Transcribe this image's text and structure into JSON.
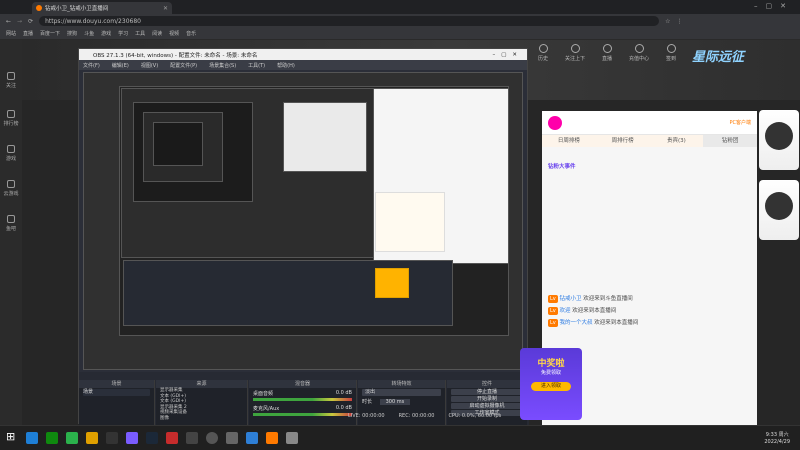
{
  "browser": {
    "tab_title": "钻戒小卫_钻戒小卫直播间",
    "url": "https://www.douyu.com/230680",
    "bookmarks": [
      "网站",
      "直播",
      "百度一下",
      "搜狗",
      "斗鱼",
      "游戏",
      "学习",
      "工具",
      "阅读",
      "视频",
      "音乐"
    ]
  },
  "left_sidebar": {
    "items": [
      "关注",
      "排行榜",
      "游戏",
      "云游戏",
      "鱼吧"
    ]
  },
  "douyu": {
    "header_nav": [
      "历史",
      "关注上下",
      "直播",
      "充值中心",
      "签到"
    ],
    "brand_text": "星际远征",
    "right_panel": {
      "tabs": [
        "日周排榜",
        "周排行榜",
        "贵宾(3)",
        "钻粉团"
      ],
      "announce": "钻粉大事件",
      "chat": [
        {
          "user": "钻戒小卫",
          "text": "欢迎来到斗鱼直播间"
        },
        {
          "user": "欢迎",
          "text": "欢迎来到本直播间"
        },
        {
          "user": "我的一个大叔",
          "text": "欢迎来到本直播间"
        }
      ],
      "badge": "PC客户端"
    }
  },
  "obs": {
    "title": "OBS 27.1.3 (64-bit, windows) - 配置文件: 未命名 - 场景: 未命名",
    "menu": [
      "文件(F)",
      "编辑(E)",
      "视图(V)",
      "配置文件(P)",
      "场景集合(S)",
      "工具(T)",
      "帮助(H)"
    ],
    "docks": {
      "scenes": "场景",
      "sources": "来源",
      "mixer": "混音器",
      "transitions": "转场特效",
      "controls": "控件"
    },
    "scene_items": [
      "场景"
    ],
    "source_items": [
      "显示器采集",
      "文本 (GDI+)",
      "文本 (GDI+)",
      "显示器采集 2",
      "视频采集设备",
      "图像"
    ],
    "mixer_tracks": [
      {
        "name": "桌面音频",
        "db": "0.0 dB"
      },
      {
        "name": "麦克风/Aux",
        "db": "0.0 dB"
      }
    ],
    "transition": {
      "type": "淡出",
      "duration_label": "时长",
      "duration": "300 ms"
    },
    "controls": [
      "停止直播",
      "开始录制",
      "启动虚拟摄像机",
      "工作室模式",
      "设置",
      "退出"
    ],
    "status": {
      "live": "LIVE: 00:00:00",
      "rec": "REC: 00:00:00",
      "cpu": "CPU: 0.0%, 60.00 fps"
    },
    "promo": {
      "title": "中奖啦",
      "subtitle": "免费领取",
      "button": "进入领取"
    }
  },
  "taskbar": {
    "time": "9:33 周六",
    "date": "2022/4/29"
  },
  "colors": {
    "accent_orange": "#ff7a00",
    "obs_bg": "#2b2e38",
    "promo_purple": "#6a44ee"
  }
}
